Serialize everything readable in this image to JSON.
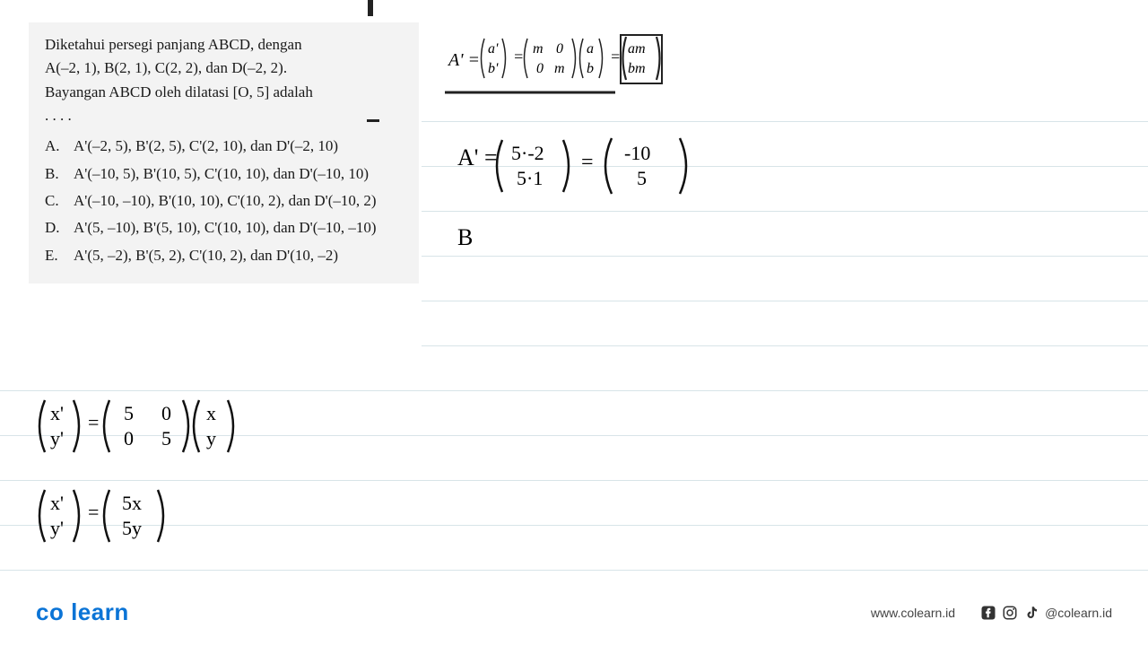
{
  "question": {
    "prompt_line1": "Diketahui persegi panjang ABCD, dengan",
    "prompt_line2": "A(–2, 1), B(2, 1), C(2, 2), dan D(–2, 2).",
    "prompt_line3": "Bayangan ABCD oleh dilatasi [O, 5] adalah",
    "dots": ". . . .",
    "options": {
      "A": "A'(–2, 5), B'(2, 5), C'(2, 10), dan D'(–2, 10)",
      "B": "A'(–10, 5), B'(10, 5), C'(10, 10), dan D'(–10, 10)",
      "C": "A'(–10, –10), B'(10, 10), C'(10, 2), dan D'(–10, 2)",
      "D": "A'(5, –10), B'(5, 10), C'(10, 10), dan D'(–10, –10)",
      "E": "A'(5, –2), B'(5, 2), C'(10, 2), dan D'(10, –2)"
    }
  },
  "formula_top": {
    "lhs": "A' =",
    "col1_top": "a'",
    "col1_bot": "b'",
    "eq": "=",
    "mat_tl": "m",
    "mat_tr": "0",
    "mat_bl": "0",
    "mat_br": "m",
    "col3_top": "a",
    "col3_bot": "b",
    "eq2": "=",
    "col4_top": "am",
    "col4_bot": "bm"
  },
  "handwritten": {
    "ap_step": {
      "label": "A' =",
      "r1": "5·-2",
      "r2": "5·1",
      "eq": "=",
      "res1": "-10",
      "res2": "5"
    },
    "answer_let": "B",
    "matrix_form": {
      "lhs_top": "x'",
      "lhs_bot": "y'",
      "m_tl": "5",
      "m_tr": "0",
      "m_bl": "0",
      "m_br": "5",
      "rhs_top": "x",
      "rhs_bot": "y"
    },
    "result_form": {
      "lhs_top": "x'",
      "lhs_bot": "y'",
      "r_top": "5x",
      "r_bot": "5y"
    }
  },
  "footer": {
    "logo": "co learn",
    "url": "www.colearn.id",
    "handle": "@colearn.id"
  }
}
